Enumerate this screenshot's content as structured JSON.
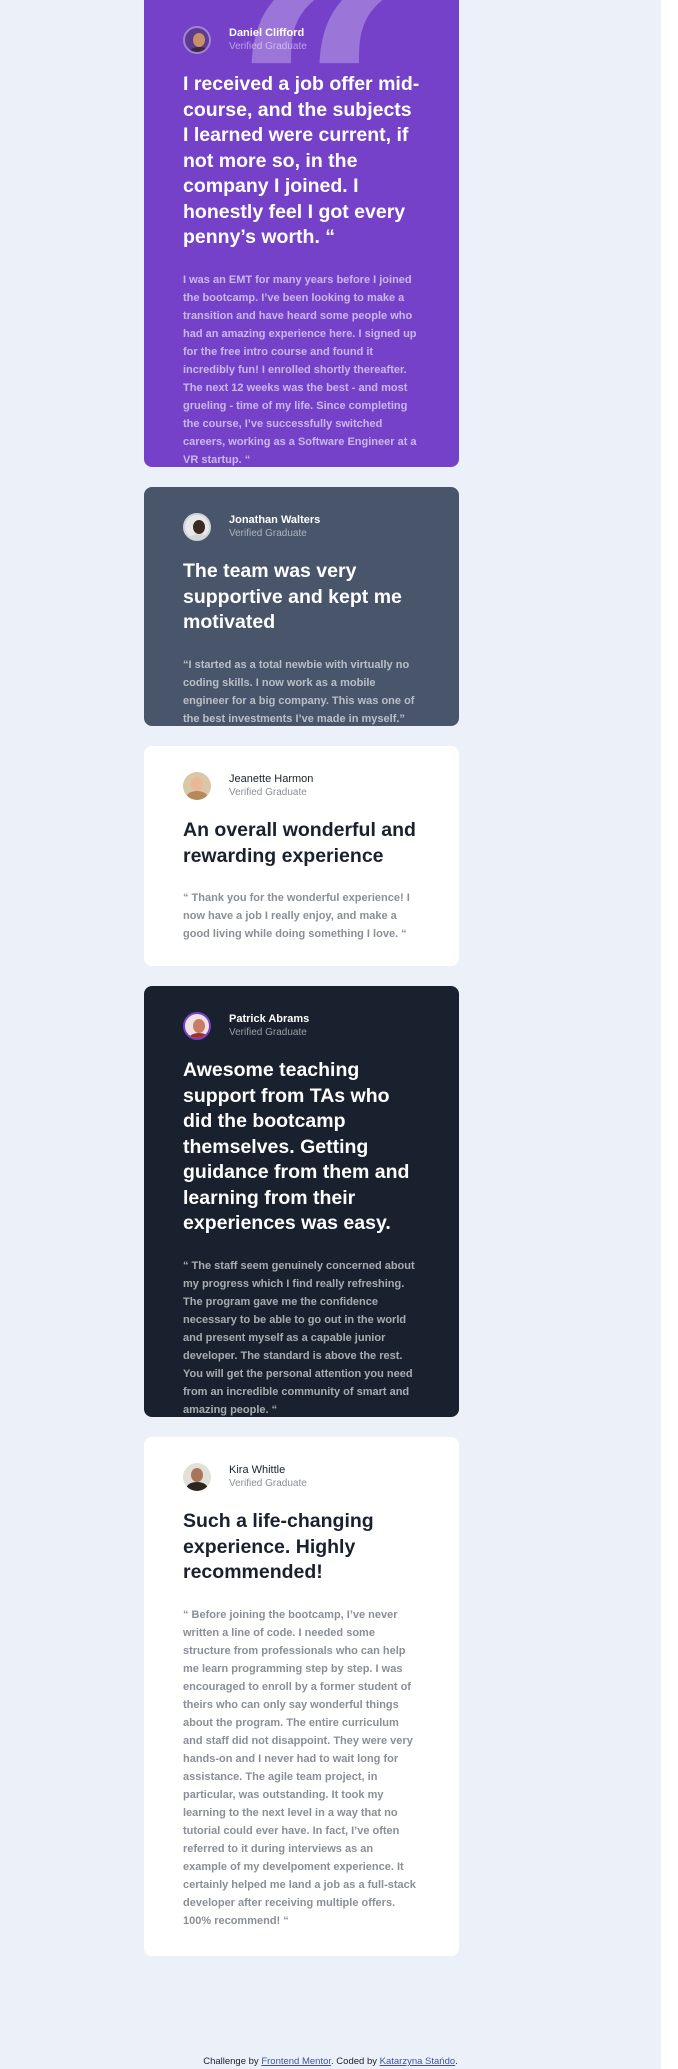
{
  "testimonials": [
    {
      "name": "Daniel Clifford",
      "role": "Verified Graduate",
      "headline": "I received a job offer mid-course, and the subjects I learned were current, if not more so, in the company I joined. I honestly feel I got every penny’s worth. “",
      "body": "I was an EMT for many years before I joined the bootcamp. I’ve been looking to make a transition and have heard some people who had an amazing experience here. I signed up for the free intro course and found it incredibly fun! I enrolled shortly thereafter. The next 12 weeks was the best - and most grueling - time of my life. Since completing the course, I’ve successfully switched careers, working as a Software Engineer at a VR startup. “",
      "background": "#7541c8"
    },
    {
      "name": "Jonathan Walters",
      "role": "Verified Graduate",
      "headline": "The team was very supportive and kept me motivated",
      "body": "“I started as a total newbie with virtually no coding skills. I now work as a mobile engineer for a big company. This was one of the best investments I’ve made in myself.”",
      "background": "#48556a"
    },
    {
      "name": "Jeanette Harmon",
      "role": "Verified Graduate",
      "headline": "An overall wonderful and rewarding experience",
      "body": "“ Thank you for the wonderful experience! I now have a job I really enjoy, and make a good living while doing something I love. “",
      "background": "#ffffff"
    },
    {
      "name": "Patrick Abrams",
      "role": "Verified Graduate",
      "headline": "Awesome teaching support from TAs who did the bootcamp themselves. Getting guidance from them and learning from their experiences was easy.",
      "body": "“ The staff seem genuinely concerned about my progress which I find really refreshing. The program gave me the confidence necessary to be able to go out in the world and present myself as a capable junior developer. The standard is above the rest. You will get the personal attention you need from an incredible community of smart and amazing people. “",
      "background": "#19212e"
    },
    {
      "name": "Kira Whittle",
      "role": "Verified Graduate",
      "headline": "Such a life-changing experience. Highly recommended!",
      "body": "“ Before joining the bootcamp, I’ve never written a line of code. I needed some structure from professionals who can help me learn programming step by step. I was encouraged to enroll by a former student of theirs who can only say wonderful things about the program. The entire curriculum and staff did not disappoint. They were very hands-on and I never had to wait long for assistance. The agile team project, in particular, was outstanding. It took my learning to the next level in a way that no tutorial could ever have. In fact, I’ve often referred to it during interviews as an example of my develpoment experience. It certainly helped me land a job as a full-stack developer after receiving multiple offers. 100% recommend! “",
      "background": "#ffffff"
    }
  ],
  "footer": {
    "prefix": "Challenge by ",
    "challenge_link": "Frontend Mentor",
    "middle": ". Coded by ",
    "author_link": "Katarzyna Stańdo",
    "suffix": "."
  },
  "colors": {
    "page_background": "#ecf1f9",
    "purple": "#7541c8",
    "grey_blue": "#48556a",
    "dark": "#19212e",
    "link": "#3e52a3"
  },
  "icons": [
    "quotation-mark-icon",
    "avatar"
  ]
}
